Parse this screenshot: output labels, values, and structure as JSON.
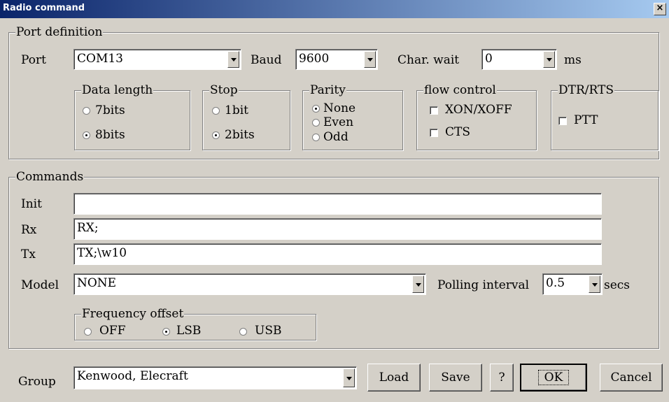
{
  "window": {
    "title": "Radio command",
    "close_glyph": "×"
  },
  "port_definition": {
    "legend": "Port definition",
    "port_label": "Port",
    "port_value": "COM13",
    "baud_label": "Baud",
    "baud_value": "9600",
    "char_wait_label": "Char. wait",
    "char_wait_value": "0",
    "char_wait_unit": "ms",
    "data_length": {
      "legend": "Data length",
      "options": [
        "7bits",
        "8bits"
      ],
      "selected": "8bits"
    },
    "stop": {
      "legend": "Stop",
      "options": [
        "1bit",
        "2bits"
      ],
      "selected": "2bits"
    },
    "parity": {
      "legend": "Parity",
      "options": [
        "None",
        "Even",
        "Odd"
      ],
      "selected": "None"
    },
    "flow_control": {
      "legend": "flow control",
      "options": [
        "XON/XOFF",
        "CTS"
      ],
      "checked": [
        false,
        false
      ]
    },
    "dtr_rts": {
      "legend": "DTR/RTS",
      "options": [
        "PTT"
      ],
      "checked": [
        false
      ]
    }
  },
  "commands": {
    "legend": "Commands",
    "init_label": "Init",
    "init_value": "",
    "rx_label": "Rx",
    "rx_value": "RX;",
    "tx_label": "Tx",
    "tx_value": "TX;\\w10",
    "model_label": "Model",
    "model_value": "NONE",
    "polling_label": "Polling interval",
    "polling_value": "0.5",
    "polling_unit": "secs",
    "frequency_offset": {
      "legend": "Frequency offset",
      "options": [
        "OFF",
        "LSB",
        "USB"
      ],
      "selected": "LSB"
    }
  },
  "footer": {
    "group_label": "Group",
    "group_value": "Kenwood, Elecraft",
    "load_label": "Load",
    "save_label": "Save",
    "help_label": "?",
    "ok_label": "OK",
    "cancel_label": "Cancel"
  },
  "colors": {
    "face": "#d4d0c8",
    "title_start": "#0a246a",
    "title_end": "#a6caf0"
  },
  "icons": [
    "close-icon",
    "dropdown-arrow-icon"
  ]
}
